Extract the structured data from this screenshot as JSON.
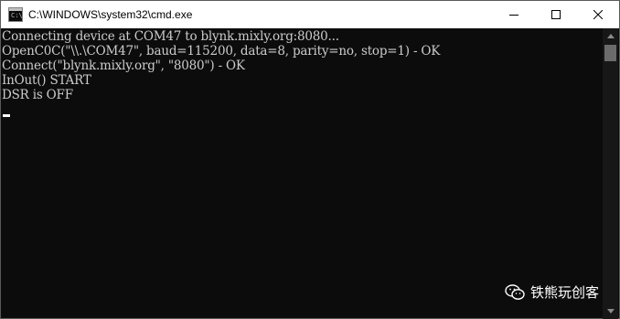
{
  "window": {
    "title": "C:\\WINDOWS\\system32\\cmd.exe",
    "icon": "cmd-icon",
    "controls": [
      "minimize-icon",
      "maximize-icon",
      "close-icon"
    ]
  },
  "console": {
    "lines": [
      "Connecting device at COM47 to blynk.mixly.org:8080...",
      "OpenC0C(\"\\\\.\\COM47\", baud=115200, data=8, parity=no, stop=1) - OK",
      "Connect(\"blynk.mixly.org\", \"8080\") - OK",
      "InOut() START",
      "DSR is OFF"
    ]
  },
  "watermark": {
    "text": "铁熊玩创客",
    "icon": "wechat-icon"
  },
  "colors": {
    "console_bg": "#0c0c0c",
    "console_text": "#cccccc",
    "titlebar_bg": "#ffffff"
  }
}
